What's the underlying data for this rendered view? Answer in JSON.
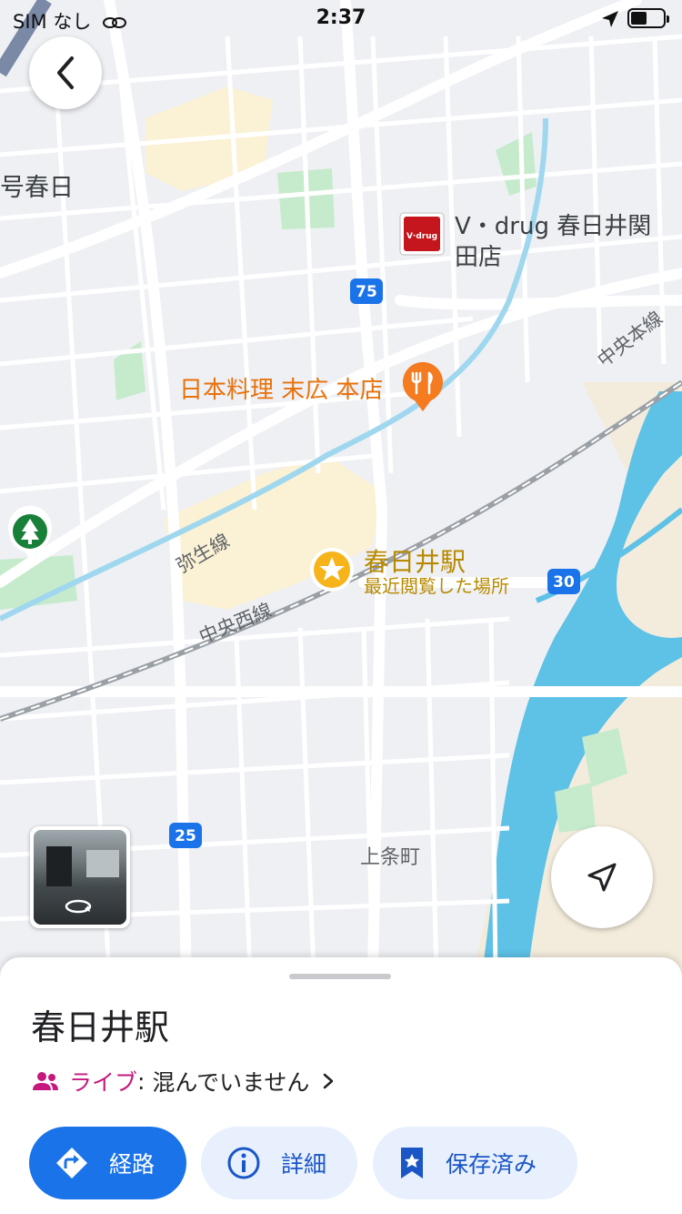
{
  "status_bar": {
    "carrier": "SIM なし",
    "time": "2:37",
    "battery_level": 0.5
  },
  "map": {
    "labels": {
      "district_partial": "号春日",
      "store_name_line1": "V・drug 春日井関",
      "store_name_line2": "田店",
      "store_logo": "V·drug",
      "restaurant": "日本料理 末広 本店",
      "station": "春日井駅",
      "station_sub": "最近閲覧した場所",
      "line_chuo_hon": "中央本線",
      "line_chuo_nishi": "中央西線",
      "line_yayoi": "弥生線",
      "town": "上条町",
      "route_75": "75",
      "route_30": "30",
      "route_25": "25"
    },
    "colors": {
      "background": "#eef0f4",
      "road": "#ffffff",
      "park": "#c6ebcc",
      "river": "#5ec1e6",
      "commercial": "#fbf1d4",
      "station_pin": "#f6b41a",
      "restaurant_pin": "#f47b20",
      "route_shield": "#1a73e8"
    },
    "icons": [
      "back-arrow-icon",
      "fork-knife-icon",
      "star-icon",
      "tree-icon",
      "navigation-arrow-icon",
      "rotate-360-icon"
    ]
  },
  "sheet": {
    "title": "春日井駅",
    "live_label": "ライブ",
    "live_sep": ":",
    "live_status": "混んでいません",
    "buttons": {
      "route": "経路",
      "details": "詳細",
      "saved": "保存済み"
    },
    "colors": {
      "primary": "#1a73e8",
      "secondary_bg": "#e8f0fe",
      "live": "#c5197d"
    }
  }
}
